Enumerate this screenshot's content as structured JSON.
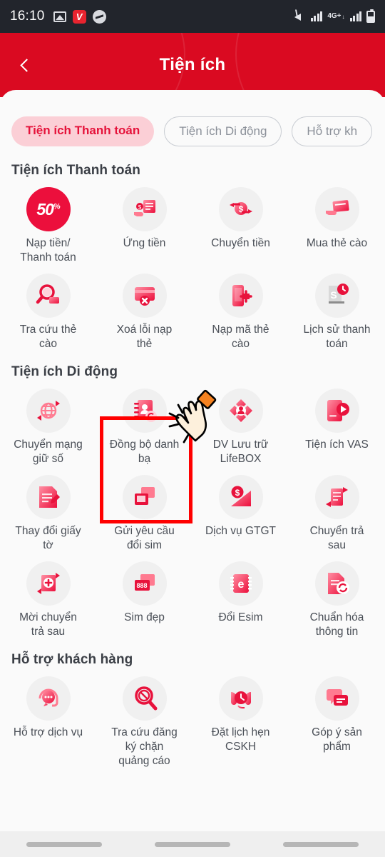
{
  "status_bar": {
    "time": "16:10",
    "left_icons": [
      "photo-icon",
      "vapp-icon",
      "messenger-icon"
    ],
    "vapp_label": "V",
    "network_label": "4G+",
    "right_icons": [
      "mute-icon",
      "signal-bars-icon",
      "network-4g-icon",
      "signal-bars-2-icon",
      "battery-icon"
    ]
  },
  "header": {
    "title": "Tiện ích",
    "back_icon": "chevron-left-icon",
    "background_color": "#da0a21"
  },
  "tabs": [
    {
      "label": "Tiện ích Thanh toán",
      "active": true
    },
    {
      "label": "Tiện ích Di động",
      "active": false
    },
    {
      "label": "Hỗ trợ kh",
      "active": false
    }
  ],
  "sections": [
    {
      "title": "Tiện ích Thanh toán",
      "items": [
        {
          "label": "Nạp tiền/\nThanh toán",
          "icon": "promo-50-percent-icon",
          "promo": "50",
          "promo_sup": "%"
        },
        {
          "label": "Ứng tiền",
          "icon": "hand-money-document-icon",
          "glyph": "💵"
        },
        {
          "label": "Chuyển tiền",
          "icon": "money-transfer-arrows-icon",
          "glyph": "$"
        },
        {
          "label": "Mua thẻ cào",
          "icon": "hand-scratch-card-icon",
          "glyph": "▭"
        },
        {
          "label": "Tra cứu thẻ\ncào",
          "icon": "magnifier-card-icon",
          "glyph": "🔍"
        },
        {
          "label": "Xoá lỗi nạp\nthẻ",
          "icon": "card-error-icon",
          "glyph": "✕"
        },
        {
          "label": "Nạp mã thẻ\ncào",
          "icon": "phone-topup-icon",
          "glyph": "📱"
        },
        {
          "label": "Lịch sử thanh\ntoán",
          "icon": "receipt-clock-icon",
          "glyph": "🕐"
        }
      ]
    },
    {
      "title": "Tiện ích Di động",
      "items": [
        {
          "label": "Chuyển mạng\ngiữ số",
          "icon": "globe-arrows-icon",
          "glyph": "🌐"
        },
        {
          "label": "Đồng bộ danh\nbạ",
          "icon": "contacts-sync-icon",
          "glyph": "📕",
          "highlighted": true
        },
        {
          "label": "DV Lưu trữ\nLifeBOX",
          "icon": "cloud-storage-person-icon",
          "glyph": "◈"
        },
        {
          "label": "Tiện ích VAS",
          "icon": "phone-play-icon",
          "glyph": "▶"
        },
        {
          "label": "Thay đổi giấy\ntờ",
          "icon": "document-edit-icon",
          "glyph": "📝"
        },
        {
          "label": "Gửi yêu cầu\nđổi sim",
          "icon": "sim-swap-icon",
          "glyph": "▤"
        },
        {
          "label": "Dịch vụ GTGT",
          "icon": "money-chart-icon",
          "glyph": "$"
        },
        {
          "label": "Chuyển trả\nsau",
          "icon": "postpaid-transfer-icon",
          "glyph": "⇄"
        },
        {
          "label": "Mời chuyển\ntrả sau",
          "icon": "invite-postpaid-icon",
          "glyph": "＋"
        },
        {
          "label": "Sim đẹp",
          "icon": "sim-888-icon",
          "promo": "888"
        },
        {
          "label": "Đổi Esim",
          "icon": "esim-chip-icon",
          "glyph": "e"
        },
        {
          "label": "Chuẩn hóa\nthông tin",
          "icon": "document-sync-icon",
          "glyph": "⟳"
        }
      ]
    },
    {
      "title": "Hỗ trợ khách hàng",
      "items": [
        {
          "label": "Hỗ trợ dịch vụ",
          "icon": "headset-chat-icon",
          "glyph": "💬"
        },
        {
          "label": "Tra cứu đăng\nký chặn\nquảng cáo",
          "icon": "magnifier-block-icon",
          "glyph": "🚫"
        },
        {
          "label": "Đặt lịch hẹn\nCSKH",
          "icon": "headset-clock-icon",
          "glyph": "🎧"
        },
        {
          "label": "Góp ý sản\nphẩm",
          "icon": "feedback-chat-icon",
          "glyph": "💭"
        }
      ]
    }
  ],
  "highlight": {
    "target_label": "Đồng bộ danh bạ",
    "border_color": "#ff0000",
    "cursor_icon": "hand-tap-icon"
  },
  "nav_bar": {
    "pills": [
      "recents-pill",
      "home-pill",
      "back-pill"
    ]
  },
  "colors": {
    "brand_red": "#da0a21",
    "accent_pink": "#fbcfd6",
    "active_tab_text": "#e5123a",
    "icon_bg": "#f0f0f0",
    "page_bg": "#fafafa"
  }
}
